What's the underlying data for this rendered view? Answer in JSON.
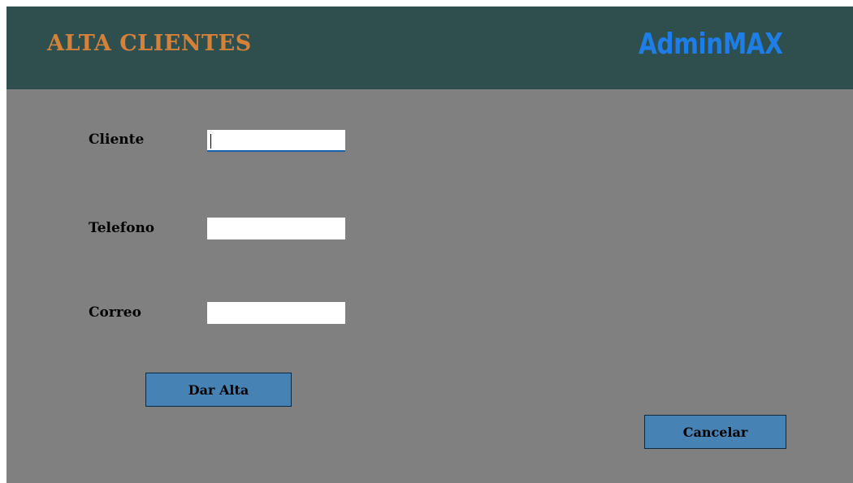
{
  "header": {
    "title": "ALTA CLIENTES",
    "brand": "AdminMAX"
  },
  "form": {
    "cliente": {
      "label": "Cliente",
      "value": ""
    },
    "telefono": {
      "label": "Telefono",
      "value": ""
    },
    "correo": {
      "label": "Correo",
      "value": ""
    }
  },
  "buttons": {
    "dar_alta": "Dar Alta",
    "cancelar": "Cancelar"
  },
  "colors": {
    "header_bg": "#2f4f4f",
    "title": "#d4813a",
    "brand": "#1e7ee8",
    "body_bg": "#808080",
    "button_bg": "#4682b4"
  }
}
